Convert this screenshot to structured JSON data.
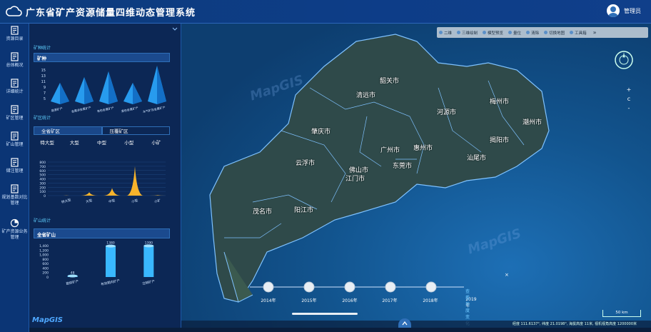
{
  "header": {
    "title": "广东省矿产资源储量四维动态管理系统",
    "user_label": "管理员"
  },
  "nav": {
    "items": [
      {
        "label": "资源目录"
      },
      {
        "label": "总体概况"
      },
      {
        "label": "详细统计"
      },
      {
        "label": "矿区管理"
      },
      {
        "label": "矿山管理"
      },
      {
        "label": "储注管理"
      },
      {
        "label": "规划基数对比管理"
      },
      {
        "label": "矿产资源业务管理"
      }
    ]
  },
  "panel": {
    "mineral_section_title": "矿种统计",
    "mineral_box_title": "矿种",
    "mineral_chart": {
      "type": "bar",
      "style": "3d-pyramid",
      "color": "#2aa8ff",
      "y_ticks": [
        "15",
        "13",
        "11",
        "9",
        "7",
        "5"
      ],
      "categories": [
        "能源矿产",
        "金属非金属矿产",
        "有色金属矿产",
        "黑色金属矿产",
        "水气矿及金属矿产"
      ],
      "values": [
        9,
        11,
        13,
        9,
        15
      ]
    },
    "area_section_title": "矿区统计",
    "area_tabs": [
      {
        "label": "全省矿区",
        "value": ""
      },
      {
        "label": "压覆矿区",
        "value": ""
      }
    ],
    "scales": [
      {
        "label": "特大型"
      },
      {
        "label": "大型"
      },
      {
        "label": "中型"
      },
      {
        "label": "小型"
      },
      {
        "label": "小矿"
      }
    ],
    "area_chart": {
      "type": "area",
      "color": "#f7b32b",
      "y_ticks": [
        "800",
        "700",
        "600",
        "500",
        "400",
        "300",
        "200",
        "100",
        "0"
      ],
      "categories": [
        "特大型",
        "大型",
        "中型",
        "小型",
        "小矿"
      ],
      "values": [
        5,
        80,
        180,
        700,
        10
      ]
    },
    "mine_section_title": "矿山统计",
    "mine_box_title": "全省矿山",
    "mine_chart": {
      "type": "bar",
      "style": "3d-cylinder",
      "color": "#39b8ff",
      "y_ticks": [
        "1,400",
        "1,200",
        "1,000",
        "800",
        "600",
        "400",
        "200",
        "0"
      ],
      "categories": [
        "勘探矿产",
        "有效期内矿产",
        "注销矿产"
      ],
      "values": [
        48,
        1380,
        1390
      ]
    }
  },
  "toolbar": {
    "items": [
      {
        "label": "二维"
      },
      {
        "label": "三维绘制"
      },
      {
        "label": "模型预览"
      },
      {
        "label": "量位"
      },
      {
        "label": "清除"
      },
      {
        "label": "切换地图"
      },
      {
        "label": "工具箱"
      }
    ],
    "more": "»"
  },
  "map": {
    "cities": [
      "韶关市",
      "清远市",
      "河源市",
      "梅州市",
      "潮州市",
      "揭阳市",
      "汕尾市",
      "惠州市",
      "东莞市",
      "广州市",
      "肇庆市",
      "佛山市",
      "江门市",
      "云浮市",
      "阳江市",
      "茂名市"
    ],
    "zoom_in": "+",
    "reset": "c",
    "zoom_out": "-",
    "close": "×",
    "watermark": "MapGIS"
  },
  "timeline": {
    "years": [
      "2014年",
      "2015年",
      "2016年",
      "2017年",
      "2018年",
      "2019年"
    ],
    "selected": "2019年",
    "label": "查看年度变化"
  },
  "scale_bar": "50 km",
  "status_bar": "经度 111.6137°, 纬度 21.0198°, 海拔高度 11米, 视机视角高度 1200000米",
  "bottom_logo": "MapGIS"
}
